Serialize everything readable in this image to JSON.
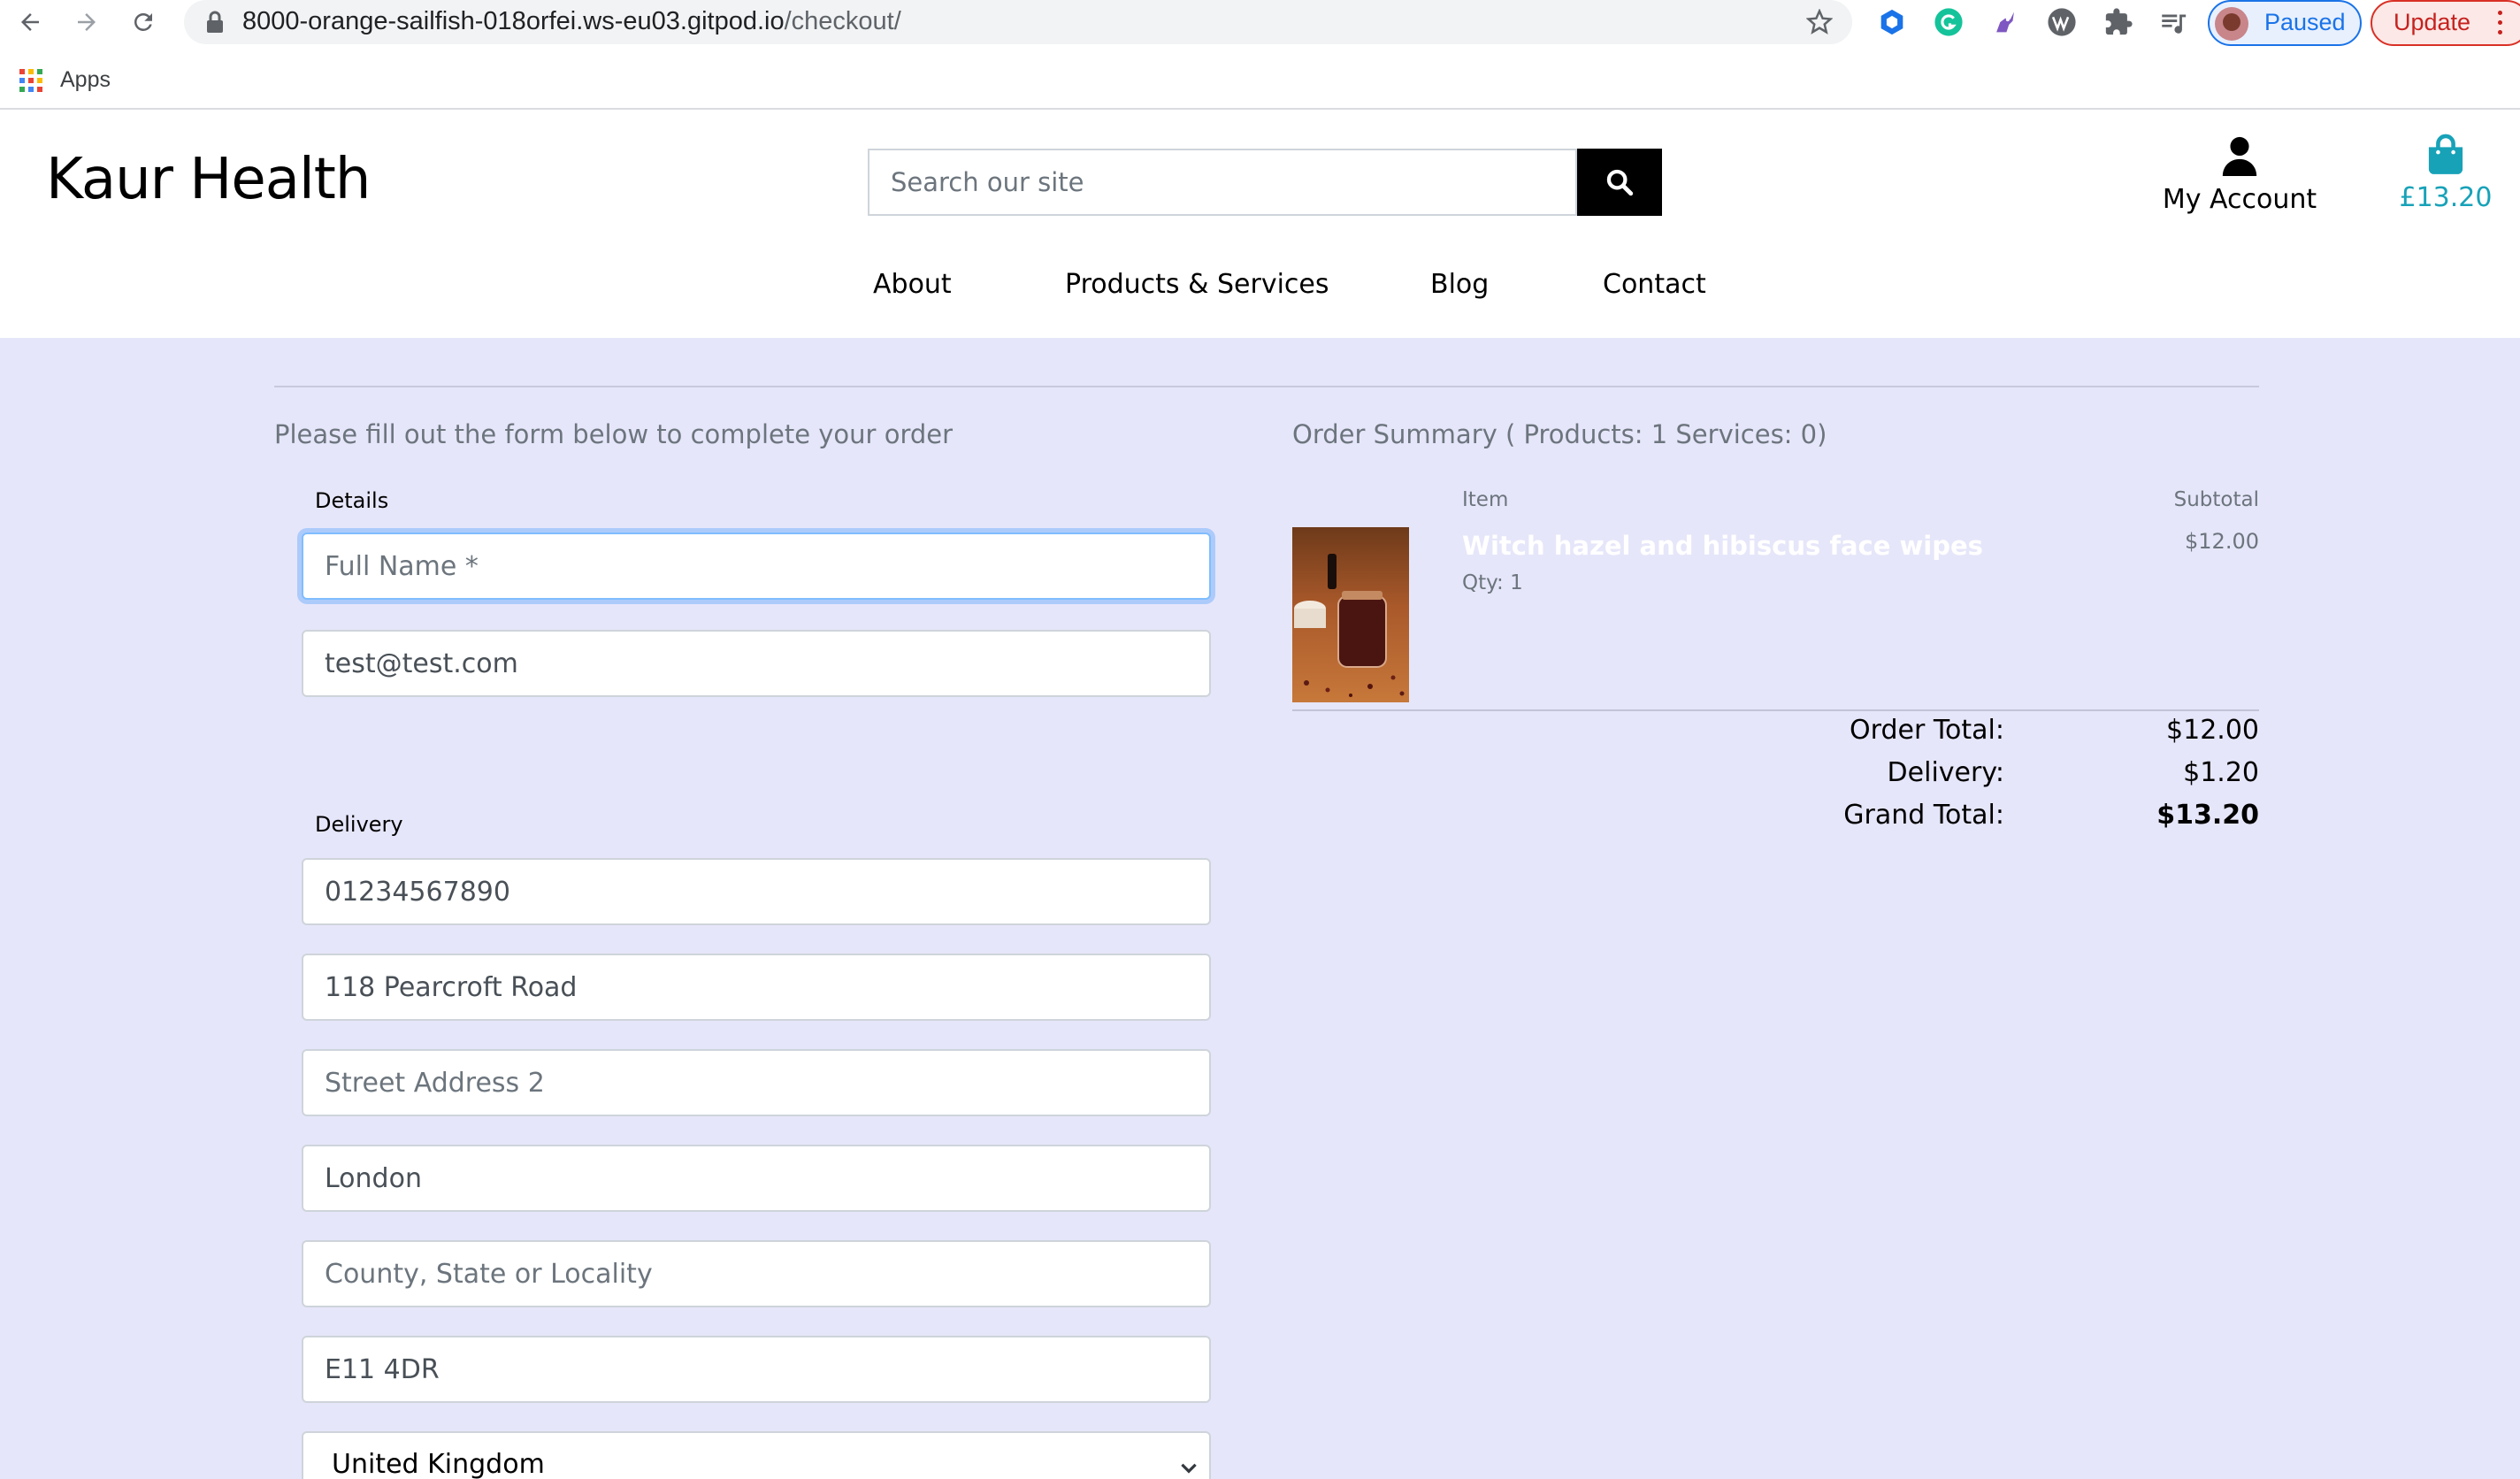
{
  "browser": {
    "url_host": "8000-orange-sailfish-018orfei.ws-eu03.gitpod.io",
    "url_path": "/checkout/",
    "profile_status": "Paused",
    "update_label": "Update",
    "bookmarks": {
      "apps_label": "Apps"
    }
  },
  "header": {
    "logo": "Kaur Health",
    "search_placeholder": "Search our site",
    "account_label": "My Account",
    "cart_total": "£13.20",
    "nav": [
      "About",
      "Products & Services",
      "Blog",
      "Contact"
    ]
  },
  "checkout": {
    "intro": "Please fill out the form below to complete your order",
    "details_legend": "Details",
    "full_name": {
      "value": "",
      "placeholder": "Full Name *"
    },
    "email": {
      "value": "test@test.com"
    },
    "delivery_legend": "Delivery",
    "phone": {
      "value": "01234567890"
    },
    "street1": {
      "value": "118 Pearcroft Road"
    },
    "street2": {
      "value": "",
      "placeholder": "Street Address 2"
    },
    "town": {
      "value": "London"
    },
    "county": {
      "value": "",
      "placeholder": "County, State or Locality"
    },
    "postcode": {
      "value": "E11 4DR"
    },
    "country": {
      "selected": "United Kingdom"
    }
  },
  "summary": {
    "title": "Order Summary ( Products: 1 Services: 0)",
    "col_item": "Item",
    "col_subtotal": "Subtotal",
    "items": [
      {
        "name": "Witch hazel and hibiscus face wipes",
        "qty": "Qty: 1",
        "subtotal": "$12.00"
      }
    ],
    "order_total_label": "Order Total:",
    "order_total": "$12.00",
    "delivery_label": "Delivery:",
    "delivery": "$1.20",
    "grand_total_label": "Grand Total:",
    "grand_total": "$13.20"
  },
  "colors": {
    "page_bg": "#e6e6fa",
    "cart_accent": "#17a2b8",
    "focus_ring": "#80bdff"
  }
}
